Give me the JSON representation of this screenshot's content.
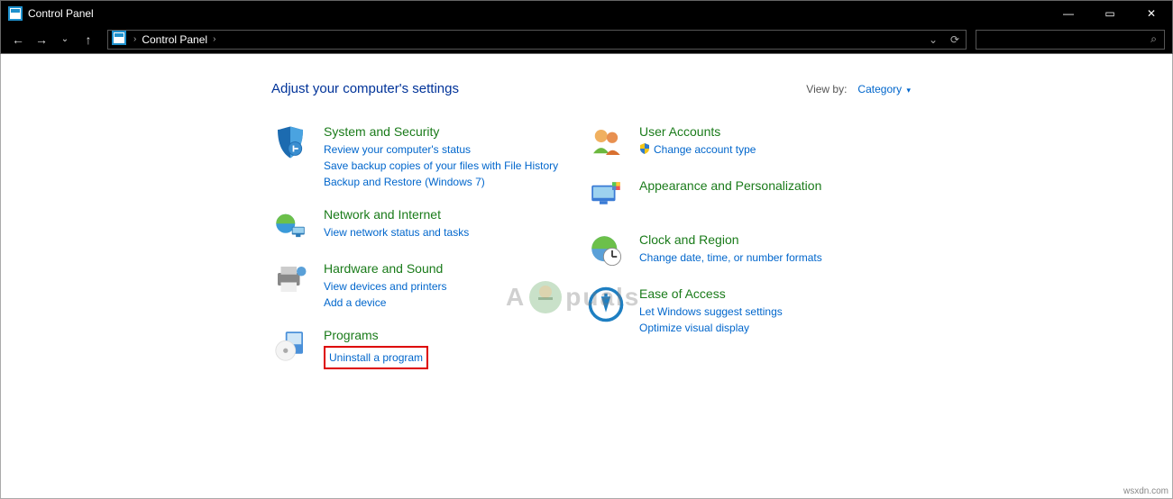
{
  "window": {
    "title": "Control Panel",
    "controls": {
      "minimize": "—",
      "maximize": "▭",
      "close": "✕"
    }
  },
  "nav": {
    "back": "←",
    "forward": "→",
    "dropdown": "⌄",
    "up": "↑",
    "breadcrumb": [
      "Control Panel"
    ],
    "refresh": "⟳",
    "addr_dropdown": "⌄",
    "search_icon": "⌕"
  },
  "heading": "Adjust your computer's settings",
  "viewby": {
    "label": "View by:",
    "value": "Category"
  },
  "left": [
    {
      "title": "System and Security",
      "links": [
        "Review your computer's status",
        "Save backup copies of your files with File History",
        "Backup and Restore (Windows 7)"
      ]
    },
    {
      "title": "Network and Internet",
      "links": [
        "View network status and tasks"
      ]
    },
    {
      "title": "Hardware and Sound",
      "links": [
        "View devices and printers",
        "Add a device"
      ]
    },
    {
      "title": "Programs",
      "links": [
        "Uninstall a program"
      ],
      "highlight": true
    }
  ],
  "right": [
    {
      "title": "User Accounts",
      "links": [
        "Change account type"
      ],
      "shield_on_first": true
    },
    {
      "title": "Appearance and Personalization",
      "links": []
    },
    {
      "title": "Clock and Region",
      "links": [
        "Change date, time, or number formats"
      ]
    },
    {
      "title": "Ease of Access",
      "links": [
        "Let Windows suggest settings",
        "Optimize visual display"
      ]
    }
  ],
  "watermark": {
    "pre": "A",
    "post": "puals"
  },
  "source": "wsxdn.com"
}
